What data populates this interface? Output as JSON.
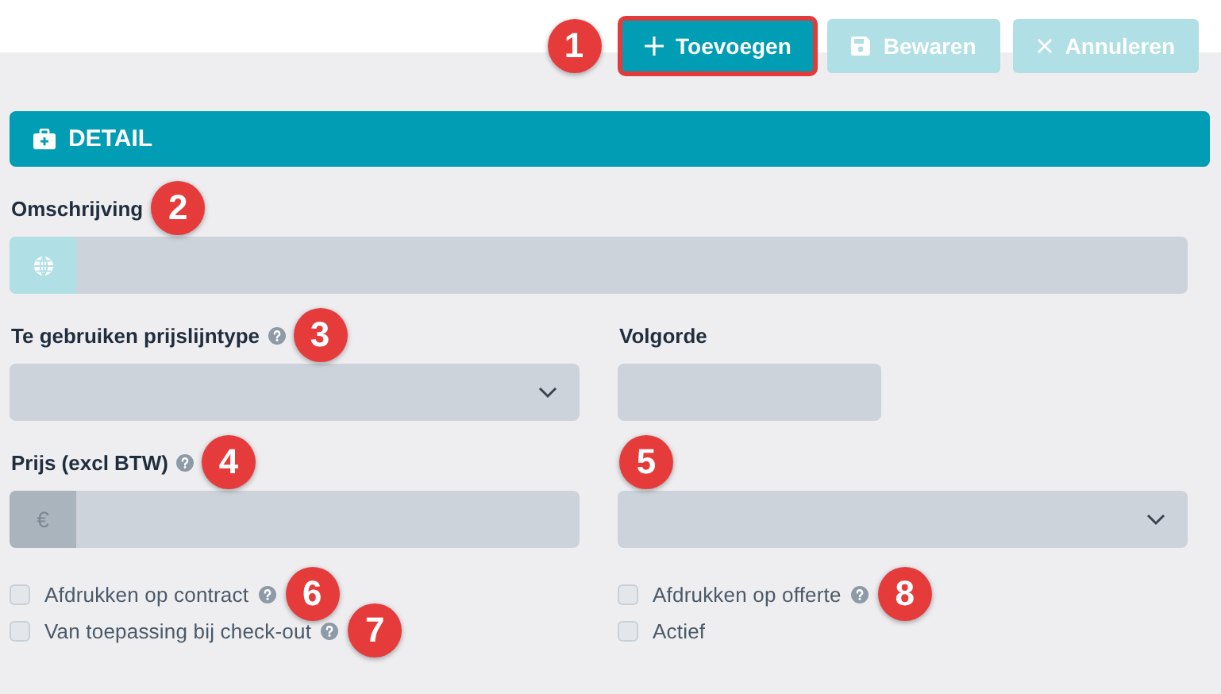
{
  "toolbar": {
    "callout": "1",
    "buttons": [
      {
        "kind": "add",
        "label": "Toevoegen",
        "disabled": false,
        "highlighted": true
      },
      {
        "kind": "save",
        "label": "Bewaren",
        "disabled": true,
        "highlighted": false
      },
      {
        "kind": "cancel",
        "label": "Annuleren",
        "disabled": true,
        "highlighted": false
      }
    ]
  },
  "section": {
    "title": "DETAIL"
  },
  "rows": [
    [
      {
        "kind": "translatable",
        "label": "Omschrijving",
        "help": false,
        "callout": "2"
      }
    ],
    [
      {
        "kind": "select",
        "label": "Te gebruiken prijslijntype",
        "help": true,
        "callout": "3"
      },
      {
        "kind": "number",
        "label": "Volgorde",
        "help": false
      }
    ],
    [
      {
        "kind": "currency",
        "label": "Prijs (excl BTW)",
        "help": true,
        "callout": "4",
        "currency_symbol": "€"
      },
      {
        "kind": "select",
        "help": false,
        "callout": "5"
      }
    ]
  ],
  "checkbox_columns": [
    [
      {
        "label": "Afdrukken op contract",
        "checked": false,
        "help": true,
        "callout": "6"
      },
      {
        "label": "Van toepassing bij check-out",
        "checked": false,
        "help": true,
        "callout": "7"
      }
    ],
    [
      {
        "label": "Afdrukken op offerte",
        "checked": false,
        "help": true,
        "callout": "8"
      },
      {
        "label": "Actief",
        "checked": false,
        "help": false
      }
    ]
  ]
}
